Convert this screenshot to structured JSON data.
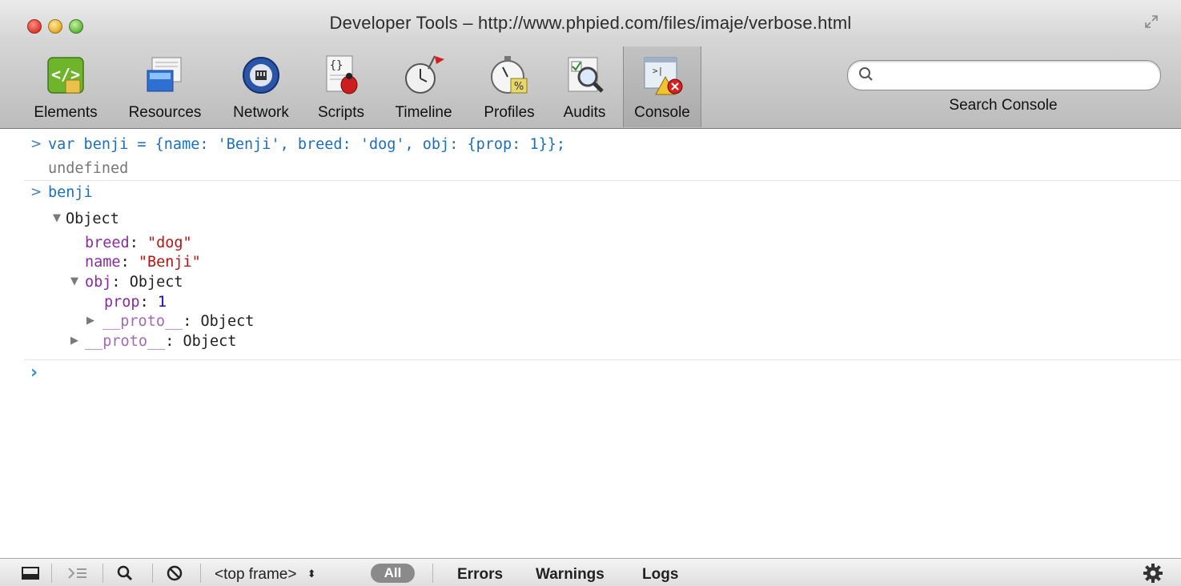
{
  "window": {
    "title": "Developer Tools – http://www.phpied.com/files/imaje/verbose.html"
  },
  "toolbar": {
    "tabs": [
      {
        "label": "Elements",
        "icon": "elements-icon"
      },
      {
        "label": "Resources",
        "icon": "resources-icon"
      },
      {
        "label": "Network",
        "icon": "network-icon"
      },
      {
        "label": "Scripts",
        "icon": "scripts-icon"
      },
      {
        "label": "Timeline",
        "icon": "timeline-icon"
      },
      {
        "label": "Profiles",
        "icon": "profiles-icon"
      },
      {
        "label": "Audits",
        "icon": "audits-icon"
      },
      {
        "label": "Console",
        "icon": "console-icon",
        "active": true
      }
    ],
    "search": {
      "value": "",
      "label": "Search Console"
    }
  },
  "console": {
    "entries": [
      {
        "command": "var benji = {name: 'Benji', breed: 'dog', obj: {prop: 1}};",
        "result": "undefined"
      },
      {
        "command": "benji",
        "tree": {
          "root": "Object",
          "props": [
            {
              "key": "breed",
              "sep": ": ",
              "value": "\"dog\""
            },
            {
              "key": "name",
              "sep": ": ",
              "value": "\"Benji\""
            }
          ],
          "obj": {
            "key": "obj",
            "sep": ": ",
            "value": "Object",
            "prop_key": "prop",
            "prop_sep": ": ",
            "prop_value": "1",
            "proto_key": "__proto__",
            "proto_sep": ": ",
            "proto_value": "Object"
          },
          "proto": {
            "key": "__proto__",
            "sep": ": ",
            "value": "Object"
          }
        }
      }
    ],
    "prompt_symbol": ">",
    "input_prompt_symbol": "›"
  },
  "statusbar": {
    "frame_select": "<top frame>",
    "filter_all": "All",
    "filters": [
      "Errors",
      "Warnings",
      "Logs"
    ]
  },
  "colors": {
    "command": "#1f6fb8",
    "string": "#b41616",
    "key": "#862d9a",
    "number": "#1c00cf"
  }
}
